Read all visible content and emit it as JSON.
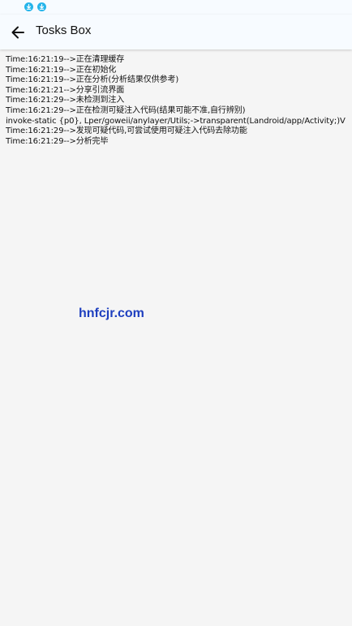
{
  "app": {
    "title": "Tosks Box"
  },
  "status_bar": {
    "icons": [
      "download-icon",
      "download-icon"
    ],
    "accent_color": "#25b4ea"
  },
  "log": {
    "lines": [
      "Time:16:21:19-->正在清理缓存",
      "Time:16:21:19-->正在初始化",
      "Time:16:21:19-->正在分析(分析结果仅供参考)",
      "Time:16:21:21-->分享引流界面",
      "Time:16:21:29-->未检测到注入",
      "Time:16:21:29-->正在检测可疑注入代码(结果可能不准,自行辨别)",
      "invoke-static {p0}, Lper/goweii/anylayer/Utils;->transparent(Landroid/app/Activity;)V",
      "Time:16:21:29-->发现可疑代码,可尝试使用可疑注入代码去除功能",
      "Time:16:21:29-->分析完毕"
    ]
  },
  "watermark": {
    "text": "hnfcjr.com"
  }
}
